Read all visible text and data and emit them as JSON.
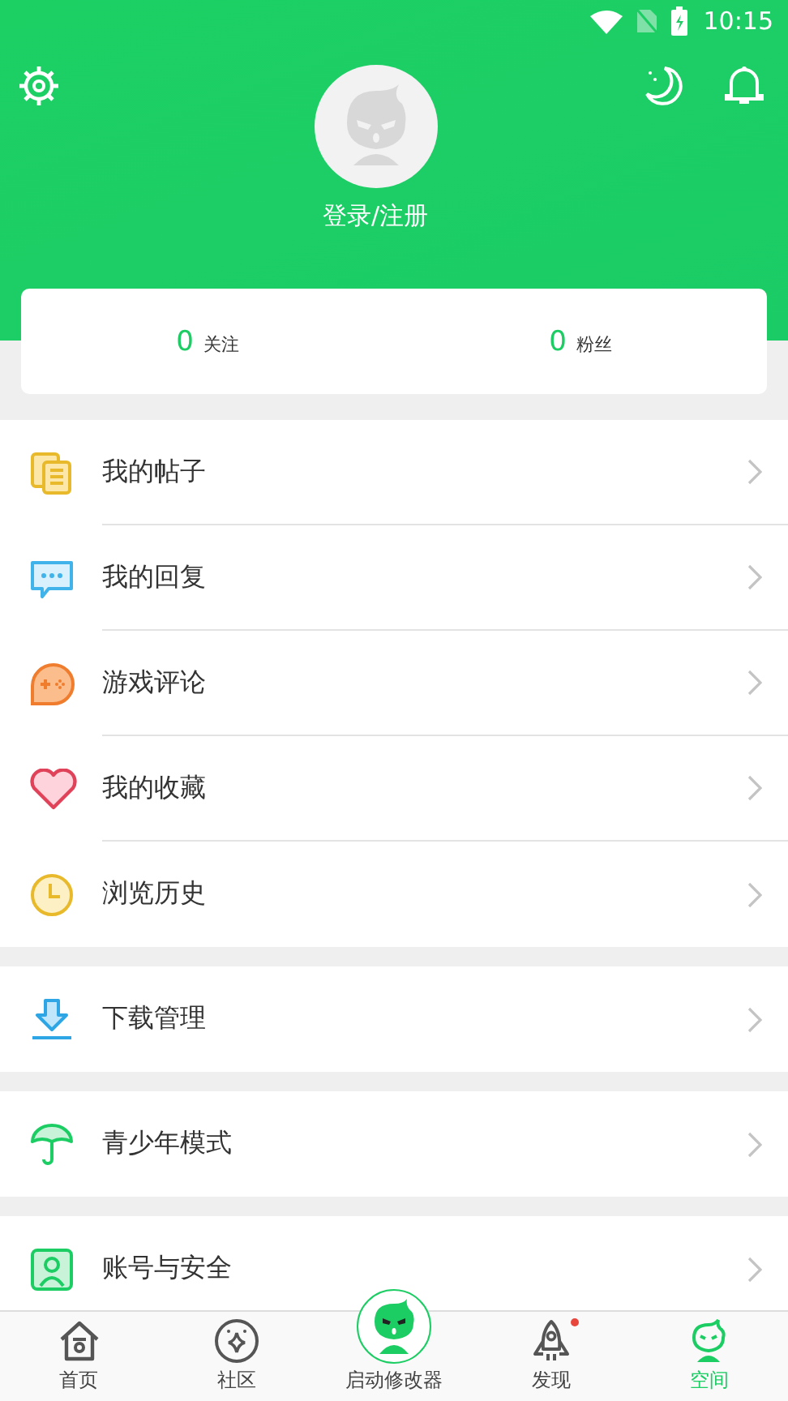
{
  "status_bar": {
    "time": "10:15"
  },
  "profile": {
    "login_label": "登录/注册"
  },
  "stats": [
    {
      "value": "0",
      "label": "关注"
    },
    {
      "value": "0",
      "label": "粉丝"
    }
  ],
  "menu_groups": [
    [
      {
        "label": "我的帖子"
      },
      {
        "label": "我的回复"
      },
      {
        "label": "游戏评论"
      },
      {
        "label": "我的收藏"
      },
      {
        "label": "浏览历史"
      }
    ],
    [
      {
        "label": "下载管理"
      }
    ],
    [
      {
        "label": "青少年模式"
      }
    ],
    [
      {
        "label": "账号与安全"
      }
    ]
  ],
  "bottom_nav": [
    {
      "label": "首页",
      "kind": "tab",
      "selected": false,
      "dot": false
    },
    {
      "label": "社区",
      "kind": "tab",
      "selected": false,
      "dot": false
    },
    {
      "label": "启动修改器",
      "kind": "center",
      "selected": false,
      "dot": false
    },
    {
      "label": "发现",
      "kind": "tab",
      "selected": false,
      "dot": true
    },
    {
      "label": "空间",
      "kind": "tab",
      "selected": true,
      "dot": false
    }
  ]
}
